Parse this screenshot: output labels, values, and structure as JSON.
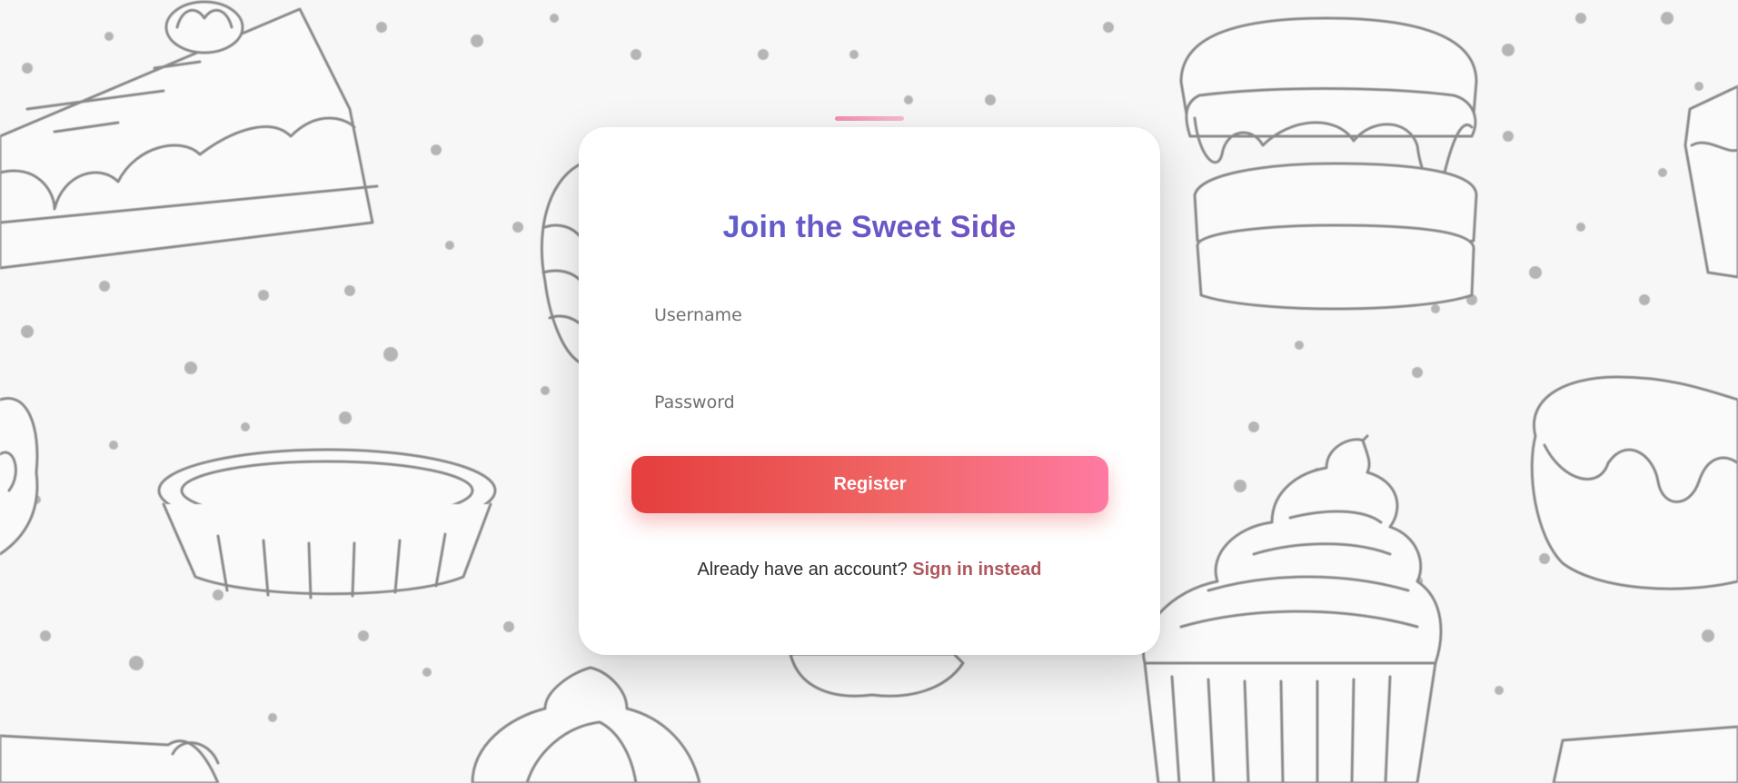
{
  "form": {
    "title": "Join the Sweet Side",
    "username_placeholder": "Username",
    "password_placeholder": "Password",
    "register_label": "Register",
    "signin_prompt": "Already have an account?",
    "signin_link": "Sign in instead"
  },
  "colors": {
    "title_gradient": [
      "#5b63d0",
      "#7e4db8"
    ],
    "button_gradient": [
      "#e53e3e",
      "#ff7aa3"
    ],
    "link": "#b0585e",
    "accent_bar": "#f48fb1"
  },
  "background": {
    "theme": "sketched desserts pattern (cake slices, tart, cupcakes, donut)"
  }
}
